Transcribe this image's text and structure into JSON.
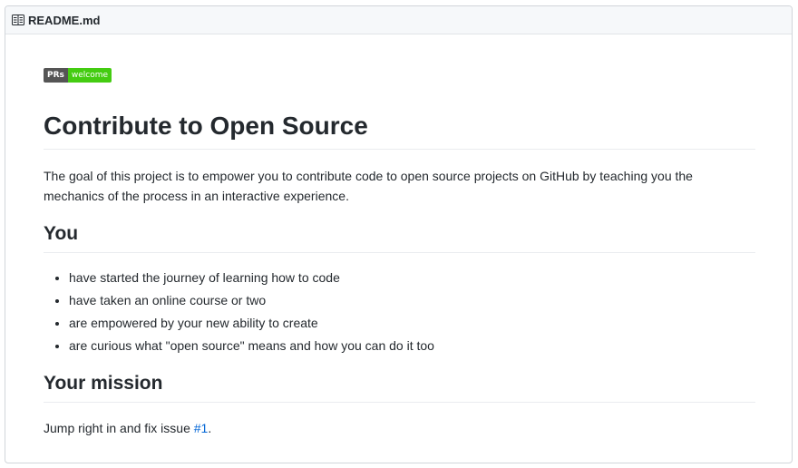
{
  "header": {
    "title": "README.md",
    "icon": "book-icon"
  },
  "badge": {
    "left": "PRs",
    "right": "welcome",
    "left_color": "#555555",
    "right_color": "#44cc11"
  },
  "readme": {
    "title": "Contribute to Open Source",
    "intro": "The goal of this project is to empower you to contribute code to open source projects on GitHub by teaching you the mechanics of the process in an interactive experience.",
    "you_heading": "You",
    "you_items": [
      "have started the journey of learning how to code",
      "have taken an online course or two",
      "are empowered by your new ability to create",
      "are curious what \"open source\" means and how you can do it too"
    ],
    "mission_heading": "Your mission",
    "mission_prefix": "Jump right in and fix issue ",
    "mission_link": "#1",
    "mission_suffix": ".",
    "link_color": "#0366d6"
  }
}
